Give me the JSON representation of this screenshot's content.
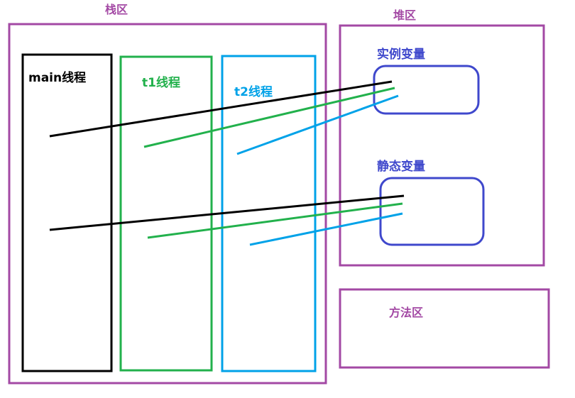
{
  "regions": {
    "stack_label": "栈区",
    "heap_label": "堆区",
    "method_label": "方法区"
  },
  "threads": {
    "main_label": "main线程",
    "t1_label": "t1线程",
    "t2_label": "t2线程"
  },
  "variables": {
    "instance_label": "实例变量",
    "static_label": "静态变量"
  },
  "colors": {
    "region": "#a349a4",
    "main_thread": "#000000",
    "t1_thread": "#22b14c",
    "t2_thread": "#00a2e8",
    "variable": "#3f48cc"
  }
}
